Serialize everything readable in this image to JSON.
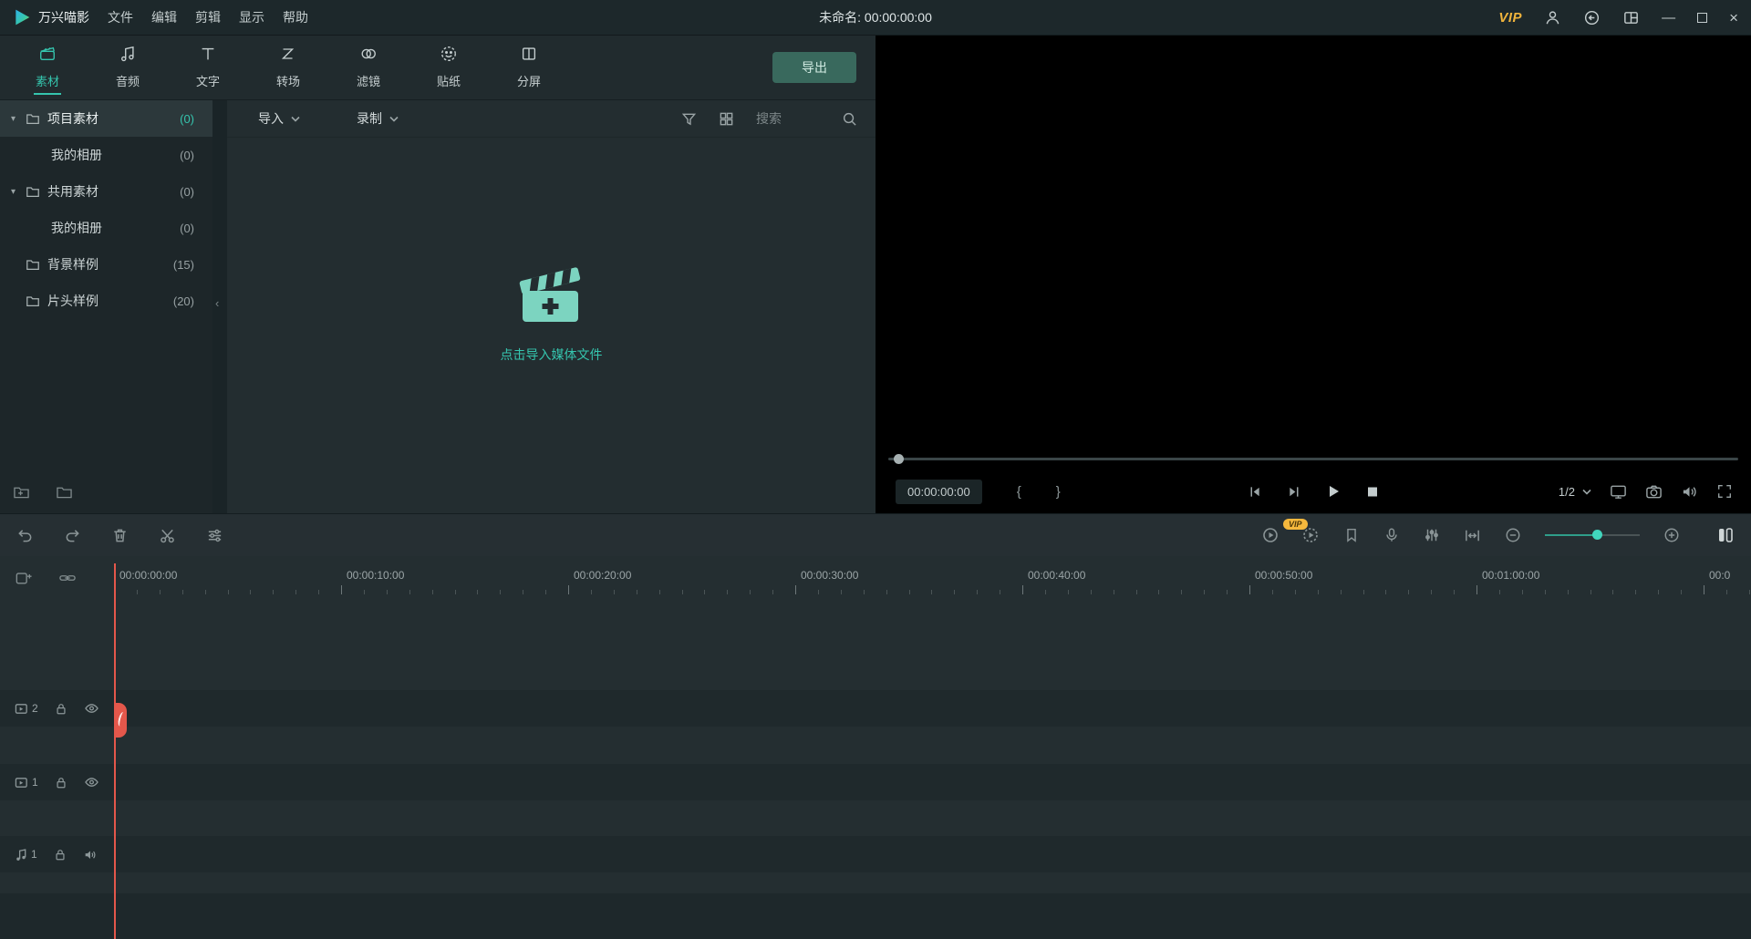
{
  "app": {
    "accent": "#35c5ae",
    "playhead_color": "#e4574b",
    "vip_color": "#f0b43c"
  },
  "menubar": {
    "app_name": "万兴喵影",
    "menus": [
      {
        "label": "文件"
      },
      {
        "label": "编辑"
      },
      {
        "label": "剪辑"
      },
      {
        "label": "显示"
      },
      {
        "label": "帮助"
      }
    ],
    "title": "未命名: 00:00:00:00",
    "vip_label": "VIP"
  },
  "tabs": {
    "export_label": "导出",
    "items": [
      {
        "id": "media",
        "label": "素材",
        "active": true
      },
      {
        "id": "audio",
        "label": "音频",
        "active": false
      },
      {
        "id": "text",
        "label": "文字",
        "active": false
      },
      {
        "id": "transition",
        "label": "转场",
        "active": false
      },
      {
        "id": "filter",
        "label": "滤镜",
        "active": false
      },
      {
        "id": "sticker",
        "label": "贴纸",
        "active": false
      },
      {
        "id": "split-screen",
        "label": "分屏",
        "active": false
      }
    ]
  },
  "sidebar": {
    "items": [
      {
        "label": "项目素材",
        "count": "(0)",
        "level": 0,
        "expanded": true,
        "selected": true
      },
      {
        "label": "我的相册",
        "count": "(0)",
        "level": 1,
        "expanded": false,
        "selected": false
      },
      {
        "label": "共用素材",
        "count": "(0)",
        "level": 0,
        "expanded": true,
        "selected": false
      },
      {
        "label": "我的相册",
        "count": "(0)",
        "level": 1,
        "expanded": false,
        "selected": false
      },
      {
        "label": "背景样例",
        "count": "(15)",
        "level": 0,
        "expanded": false,
        "selected": false
      },
      {
        "label": "片头样例",
        "count": "(20)",
        "level": 0,
        "expanded": false,
        "selected": false
      }
    ]
  },
  "media": {
    "import_label": "导入",
    "record_label": "录制",
    "search_placeholder": "搜索",
    "empty_text": "点击导入媒体文件"
  },
  "preview": {
    "current_time": "00:00:00:00",
    "mark_in": "{",
    "mark_out": "}",
    "zoom_level": "1/2"
  },
  "toolbar": {
    "vip_badge": "VIP"
  },
  "timeline": {
    "ruler_labels": [
      "00:00:00:00",
      "00:00:10:00",
      "00:00:20:00",
      "00:00:30:00",
      "00:00:40:00",
      "00:00:50:00",
      "00:01:00:00",
      "00:0"
    ],
    "tracks": [
      {
        "kind": "video",
        "number": "2"
      },
      {
        "kind": "video",
        "number": "1"
      },
      {
        "kind": "audio",
        "number": "1"
      }
    ]
  },
  "icons": {
    "expander": "▾",
    "collapse_handle": "‹",
    "minimize": "—",
    "close": "×"
  }
}
